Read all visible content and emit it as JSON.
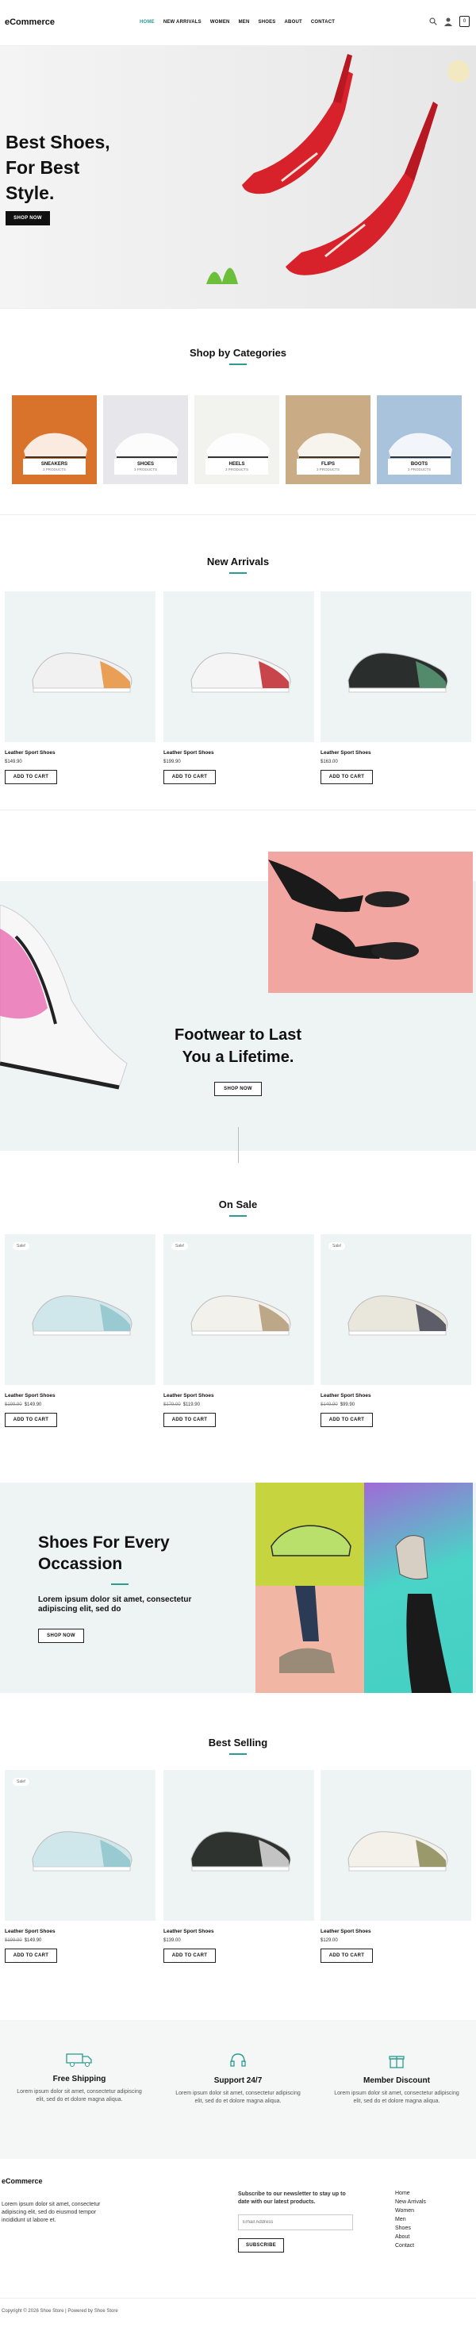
{
  "header": {
    "logo": "eCommerce",
    "nav": [
      "HOME",
      "NEW ARRIVALS",
      "WOMEN",
      "MEN",
      "SHOES",
      "ABOUT",
      "CONTACT"
    ],
    "cart_count": "0"
  },
  "hero": {
    "title_line1": "Best Shoes,",
    "title_line2": "For Best",
    "title_line3": "Style.",
    "button": "SHOP NOW"
  },
  "categories": {
    "title": "Shop by Categories",
    "items": [
      {
        "name": "SNEAKERS",
        "count": "3 PRODUCTS",
        "bg": "#d9732b"
      },
      {
        "name": "SHOES",
        "count": "3 PRODUCTS",
        "bg": "#e7e6ea"
      },
      {
        "name": "HEELS",
        "count": "3 PRODUCTS",
        "bg": "#f2f2ee"
      },
      {
        "name": "FLIPS",
        "count": "3 PRODUCTS",
        "bg": "#c9ab86"
      },
      {
        "name": "BOOTS",
        "count": "3 PRODUCTS",
        "bg": "#a9c3dc"
      }
    ]
  },
  "new_arrivals": {
    "title": "New Arrivals",
    "products": [
      {
        "name": "Leather Sport Shoes",
        "price": "$149.90",
        "button": "ADD TO CART"
      },
      {
        "name": "Leather Sport Shoes",
        "price": "$199.90",
        "button": "ADD TO CART"
      },
      {
        "name": "Leather Sport Shoes",
        "price": "$163.00",
        "button": "ADD TO CART"
      }
    ]
  },
  "banner1": {
    "line1": "Footwear to Last",
    "line2": "You a Lifetime.",
    "button": "SHOP NOW"
  },
  "on_sale": {
    "title": "On Sale",
    "products": [
      {
        "name": "Leather Sport Shoes",
        "old_price": "$199.90",
        "price": "$149.90",
        "badge": "Sale!",
        "button": "ADD TO CART"
      },
      {
        "name": "Leather Sport Shoes",
        "old_price": "$179.00",
        "price": "$119.90",
        "badge": "Sale!",
        "button": "ADD TO CART"
      },
      {
        "name": "Leather Sport Shoes",
        "old_price": "$149.90",
        "price": "$99.90",
        "badge": "Sale!",
        "button": "ADD TO CART"
      }
    ]
  },
  "banner2": {
    "line1": "Shoes For Every",
    "line2": "Occassion",
    "text": "Lorem ipsum dolor sit amet, consectetur adipiscing elit, sed do",
    "button": "SHOP NOW"
  },
  "best_selling": {
    "title": "Best Selling",
    "products": [
      {
        "name": "Leather Sport Shoes",
        "old_price": "$199.90",
        "price": "$149.90",
        "badge": "Sale!",
        "button": "ADD TO CART"
      },
      {
        "name": "Leather Sport Shoes",
        "price": "$139.00",
        "button": "ADD TO CART"
      },
      {
        "name": "Leather Sport Shoes",
        "price": "$129.00",
        "button": "ADD TO CART"
      }
    ]
  },
  "features": [
    {
      "title": "Free Shipping",
      "text": "Lorem ipsum dolor sit amet, consectetur adipiscing elit, sed do et dolore magna aliqua."
    },
    {
      "title": "Support 24/7",
      "text": "Lorem ipsum dolor sit amet, consectetur adipiscing elit, sed do et dolore magna aliqua."
    },
    {
      "title": "Member Discount",
      "text": "Lorem ipsum dolor sit amet, consectetur adipiscing elit, sed do et dolore magna aliqua."
    }
  ],
  "footer": {
    "logo": "eCommerce",
    "about": "Lorem ipsum dolor sit amet, consectetur adipiscing elit, sed do eiusmod tempor incididunt ut labore et.",
    "newsletter_text": "Subscribe to our newsletter to stay up to date with our latest products.",
    "email_placeholder": "Email Address",
    "subscribe": "SUBSCRIBE",
    "links": [
      "Home",
      "New Arrivals",
      "Women",
      "Men",
      "Shoes",
      "About",
      "Contact"
    ],
    "copyright": "Copyright © 2026 Shoe Store | Powered by Shoe Store"
  }
}
